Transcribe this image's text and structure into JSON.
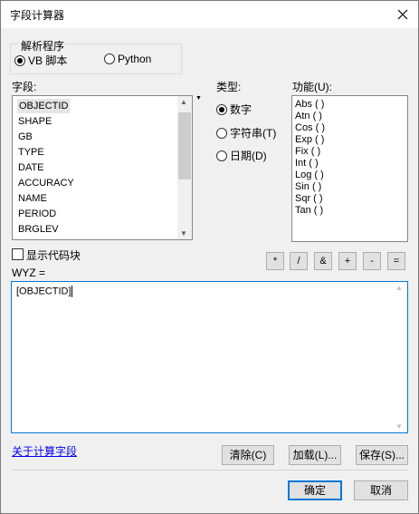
{
  "window": {
    "title": "字段计算器"
  },
  "parser": {
    "legend": "解析程序",
    "options": [
      {
        "label": "VB 脚本",
        "checked": true
      },
      {
        "label": "Python",
        "checked": false
      }
    ]
  },
  "fields": {
    "label": "字段:",
    "items": [
      "OBJECTID",
      "SHAPE",
      "GB",
      "TYPE",
      "DATE",
      "ACCURACY",
      "NAME",
      "PERIOD",
      "BRGLEV"
    ],
    "selected": "OBJECTID"
  },
  "type": {
    "label": "类型:",
    "options": [
      {
        "label": "数字",
        "checked": true
      },
      {
        "label": "字符串(T)",
        "checked": false
      },
      {
        "label": "日期(D)",
        "checked": false
      }
    ]
  },
  "functions": {
    "label": "功能(U):",
    "items": [
      "Abs ( )",
      "Atn ( )",
      "Cos ( )",
      "Exp ( )",
      "Fix ( )",
      "Int ( )",
      "Log ( )",
      "Sin ( )",
      "Sqr ( )",
      "Tan ( )"
    ]
  },
  "operators": [
    "*",
    "/",
    "&",
    "+",
    "-",
    "="
  ],
  "show_codeblock": {
    "label": "显示代码块",
    "checked": false
  },
  "expression": {
    "label": "WYZ =",
    "value": "[OBJECTID]"
  },
  "help_link": "关于计算字段",
  "buttons": {
    "clear": "清除(C)",
    "load": "加载(L)...",
    "save": "保存(S)...",
    "ok": "确定",
    "cancel": "取消"
  }
}
